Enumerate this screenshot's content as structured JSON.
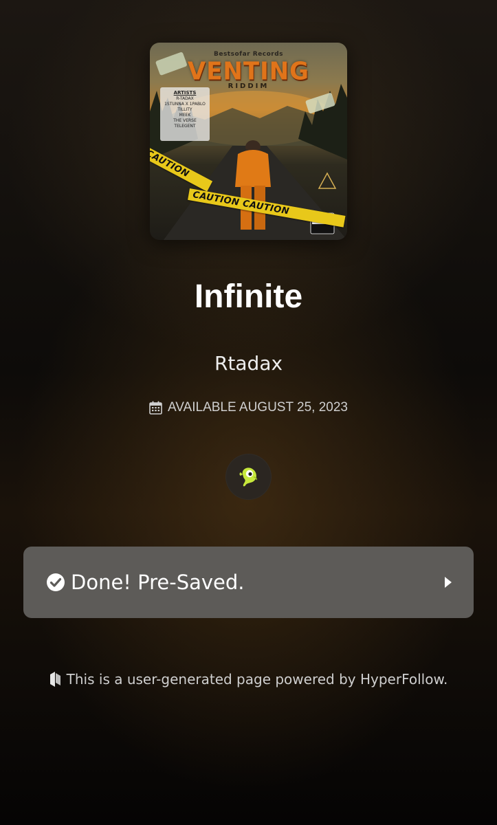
{
  "album_art": {
    "label": "Bestsofar Records",
    "title": "VENTING",
    "subtitle": "RIDDIM",
    "artists_header": "ARTISTS",
    "artists": [
      "R-TADAX",
      "1STUNNA X 1PABLO",
      "TILLITY",
      "MEEK",
      "THE VERSE",
      "TELEGENT"
    ],
    "tape_text_1": "CAUTION",
    "tape_text_2": "CAUTION   CAUTION"
  },
  "release": {
    "title": "Infinite",
    "artist": "Rtadax",
    "availability": "AVAILABLE AUGUST 25, 2023"
  },
  "service": {
    "icon": "deezer-style-green-creature-icon"
  },
  "presave_button": {
    "label": "Done! Pre-Saved.",
    "check_icon": "check-circle-icon",
    "arrow_icon": "play-arrow-icon"
  },
  "footer": {
    "text": "This is a user-generated page powered by HyperFollow.",
    "logo_icon": "hyperfollow-logo-icon"
  },
  "colors": {
    "button_bg": "#5d5b58",
    "text_primary": "#ffffff",
    "text_secondary": "#cfcfcf",
    "album_title_orange": "#e0741a",
    "caution_yellow": "#e8c81a"
  }
}
